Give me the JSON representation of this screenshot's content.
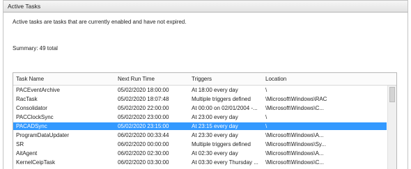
{
  "panel": {
    "title": "Active Tasks"
  },
  "description": "Active tasks are tasks that are currently enabled and have not expired.",
  "summary": "Summary: 49 total",
  "columns": {
    "name": "Task Name",
    "next_run": "Next Run Time",
    "triggers": "Triggers",
    "location": "Location"
  },
  "rows": [
    {
      "name": "PACEventArchive",
      "next_run": "05/02/2020 18:00:00",
      "triggers": "At 18:00 every day",
      "location": "\\"
    },
    {
      "name": "RacTask",
      "next_run": "05/02/2020 18:07:48",
      "triggers": "Multiple triggers defined",
      "location": "\\Microsoft\\Windows\\RAC"
    },
    {
      "name": "Consolidator",
      "next_run": "05/02/2020 22:00:00",
      "triggers": "At 00:00 on 02/01/2004 -...",
      "location": "\\Microsoft\\Windows\\C..."
    },
    {
      "name": "PACClockSync",
      "next_run": "05/02/2020 23:00:00",
      "triggers": "At 23:00 every day",
      "location": "\\"
    },
    {
      "name": "PACADSync",
      "next_run": "05/02/2020 23:15:00",
      "triggers": "At 23:15 every day",
      "location": "\\"
    },
    {
      "name": "ProgramDataUpdater",
      "next_run": "06/02/2020 00:33:44",
      "triggers": "At 23:30 every day",
      "location": "\\Microsoft\\Windows\\A..."
    },
    {
      "name": "SR",
      "next_run": "06/02/2020 00:00:00",
      "triggers": "Multiple triggers defined",
      "location": "\\Microsoft\\Windows\\Sy..."
    },
    {
      "name": "AitAgent",
      "next_run": "06/02/2020 02:30:00",
      "triggers": "At 02:30 every day",
      "location": "\\Microsoft\\Windows\\A..."
    },
    {
      "name": "KernelCeipTask",
      "next_run": "06/02/2020 03:30:00",
      "triggers": "At 03:30 every Thursday ...",
      "location": "\\Microsoft\\Windows\\C..."
    }
  ],
  "selected_row_index": 4,
  "colors": {
    "selection": "#3399ff",
    "header_bg": "#e9e9e9"
  }
}
